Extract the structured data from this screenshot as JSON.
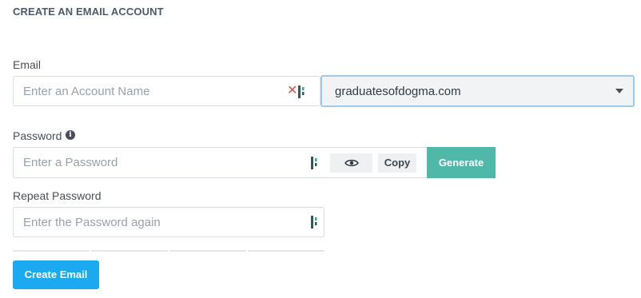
{
  "page": {
    "title": "CREATE AN EMAIL ACCOUNT"
  },
  "email": {
    "label": "Email",
    "account_placeholder": "Enter an Account Name",
    "account_value": "",
    "domain_selected": "graduatesofdogma.com"
  },
  "password": {
    "label": "Password",
    "placeholder": "Enter a Password",
    "value": "",
    "copy_label": "Copy",
    "generate_label": "Generate"
  },
  "repeat_password": {
    "label": "Repeat Password",
    "placeholder": "Enter the Password again",
    "value": ""
  },
  "actions": {
    "create_label": "Create Email"
  },
  "icons": {
    "clear": "close-icon",
    "bitwarden": "password-manager-icon",
    "info": "info-icon",
    "eye": "eye-icon",
    "caret": "chevron-down-icon"
  },
  "colors": {
    "generate_button": "#50b8a8",
    "create_button": "#1ba9f0",
    "clear_icon": "#d9534f",
    "select_focus_border": "#9fc9e8"
  }
}
